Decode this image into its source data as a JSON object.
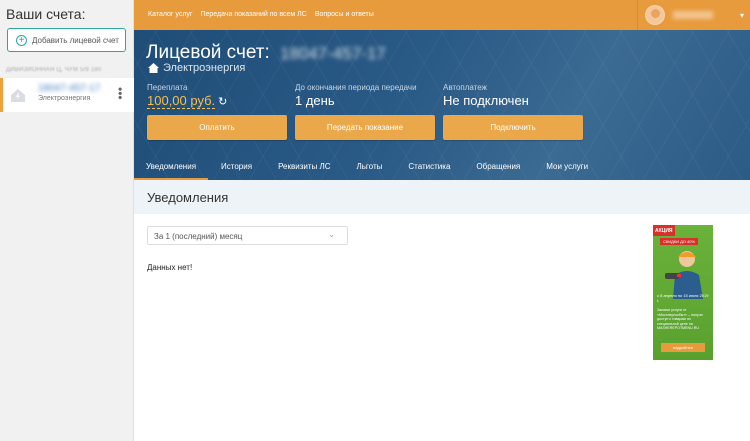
{
  "sidebar": {
    "title": "Ваши счета:",
    "add_button": "Добавить лицевой счет",
    "address": "ДИВИЗИОННАЯ Ц, ЧУМ 5/9 180",
    "account": {
      "number": "18047-457-17",
      "service": "Электроэнергия"
    }
  },
  "topnav": {
    "items": [
      "Каталог услуг",
      "Передача показаний по всем ЛС",
      "Вопросы и ответы"
    ],
    "username": "Имя"
  },
  "banner": {
    "title": "Лицевой счет:",
    "account_number": "18047-457-17",
    "service": "Электроэнергия",
    "overpay_label": "Переплата",
    "overpay_value": "100,00 руб.",
    "period_label": "До окончания периода передачи",
    "period_value": "1 день",
    "autopay_label": "Автоплатеж",
    "autopay_value": "Не подключен",
    "buttons": {
      "pay": "Оплатить",
      "submit": "Передать показание",
      "connect": "Подключить"
    }
  },
  "tabs": [
    "Уведомления",
    "История",
    "Реквизиты ЛС",
    "Льготы",
    "Статистика",
    "Обращения",
    "Мои услуги"
  ],
  "content": {
    "section_title": "Уведомления",
    "period": "За 1 (последний) месяц",
    "no_data": "Данных нет!"
  },
  "ad": {
    "tag": "АКЦИЯ",
    "sale": "СКИДКИ ДО 40%",
    "dates": "с 8 апреля по 15 июля 2019 г.",
    "text": "Заказчи услуги от «Мосэнергосбыт» – получи доступ к товарам по специальной цене на MASHEREPOTMENU.RU",
    "button": "подробнее"
  },
  "colors": {
    "accent": "#e89b3c",
    "banner": "#2a5a86",
    "teal": "#2ea3a3",
    "amount": "#f6c04d"
  }
}
